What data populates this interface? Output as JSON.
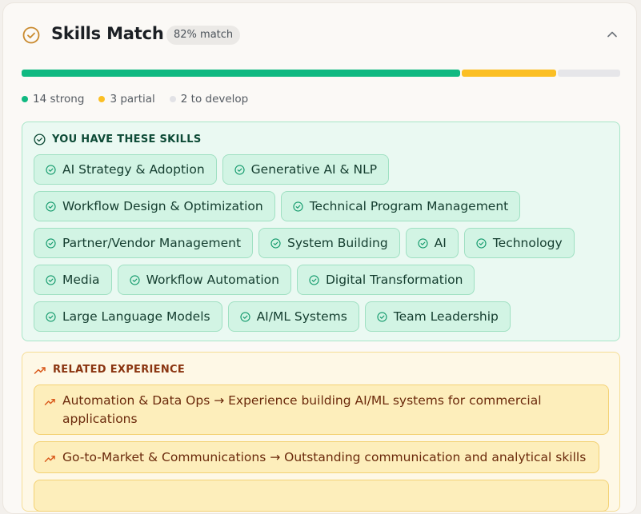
{
  "header": {
    "title": "Skills Match",
    "badge": "82% match"
  },
  "progress": {
    "strong_count": 14,
    "partial_count": 3,
    "develop_count": 2,
    "colors": {
      "strong": "#10b981",
      "partial": "#fbbf24",
      "develop": "#e6e6e9"
    }
  },
  "legend": {
    "strong": "14 strong",
    "partial": "3 partial",
    "develop": "2 to develop"
  },
  "skills": {
    "heading": "YOU HAVE THESE SKILLS",
    "items": [
      "AI Strategy & Adoption",
      "Generative AI & NLP",
      "Workflow Design & Optimization",
      "Technical Program Management",
      "Partner/Vendor Management",
      "System Building",
      "AI",
      "Technology",
      "Media",
      "Workflow Automation",
      "Digital Transformation",
      "Large Language Models",
      "AI/ML Systems",
      "Team Leadership"
    ]
  },
  "related": {
    "heading": "RELATED EXPERIENCE",
    "items": [
      "Automation & Data Ops → Experience building AI/ML systems for commercial applications",
      "Go-to-Market & Communications → Outstanding communication and analytical skills"
    ]
  }
}
